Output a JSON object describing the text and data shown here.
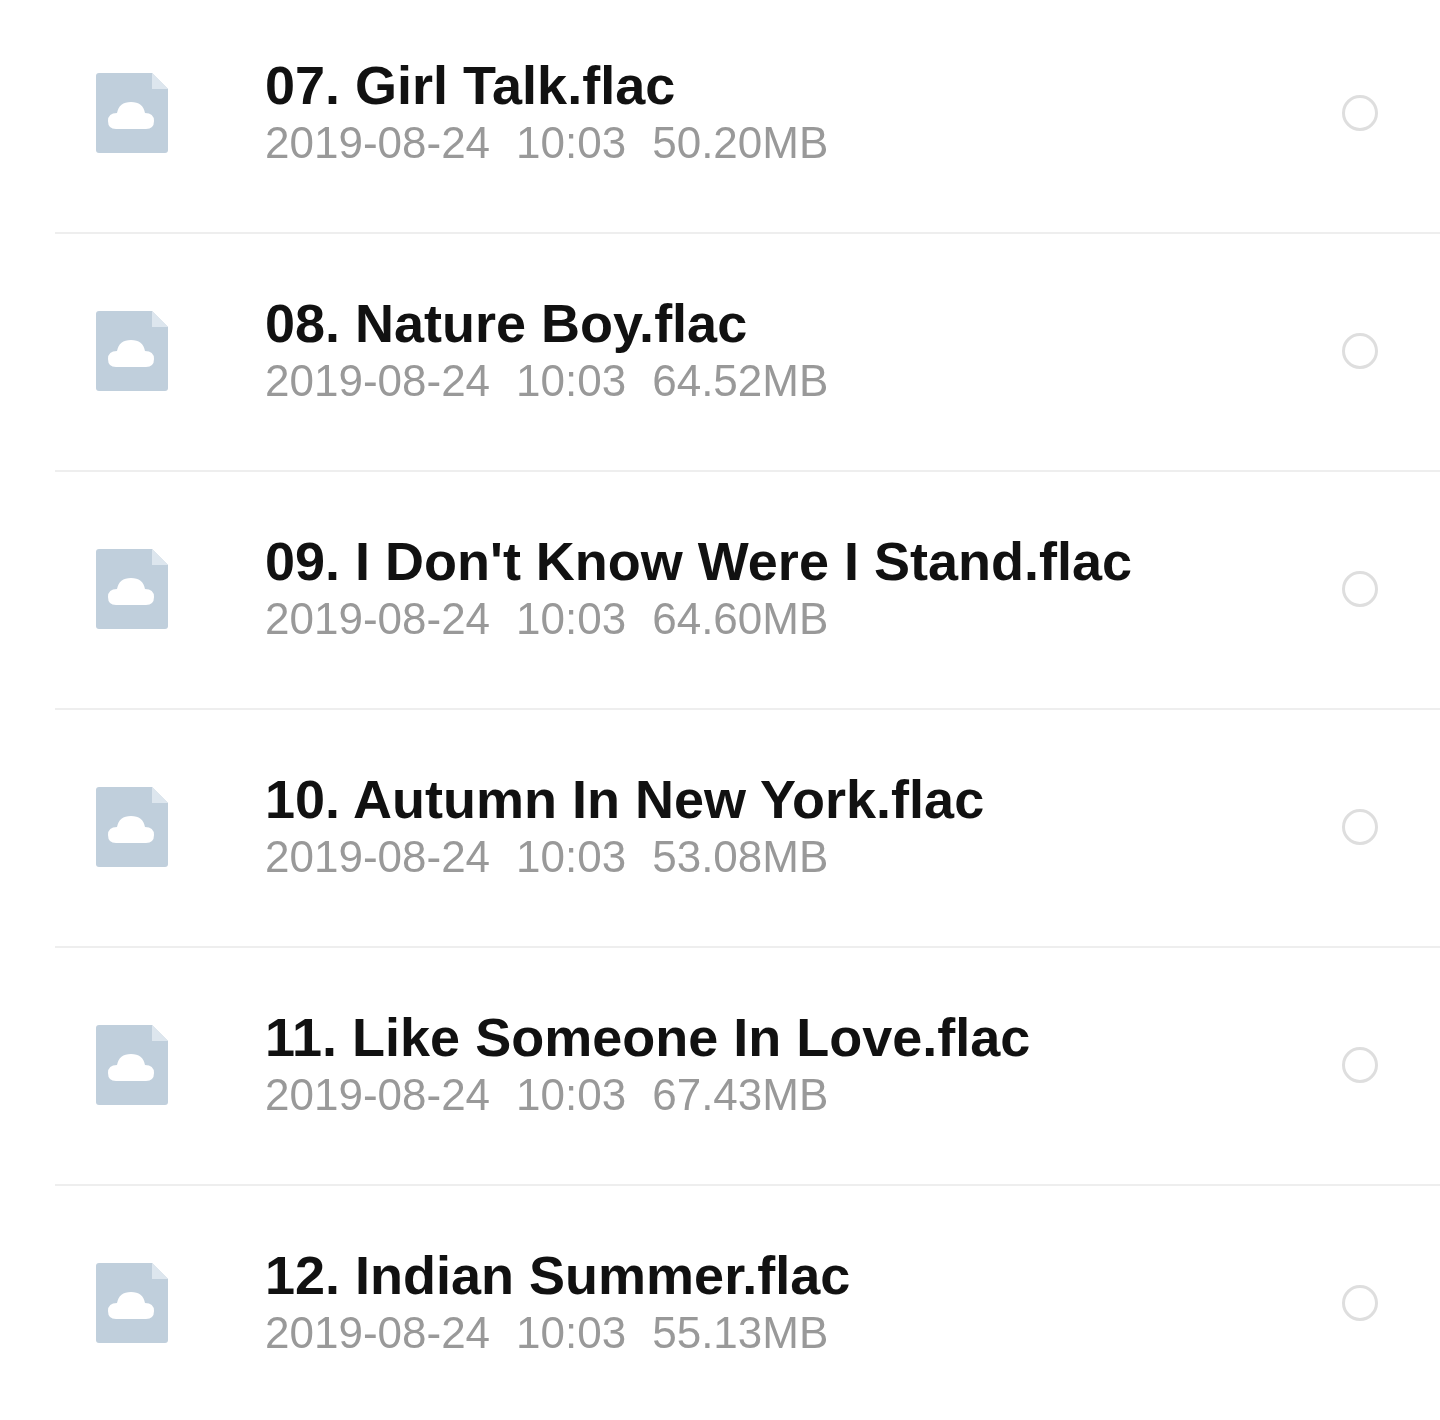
{
  "files": [
    {
      "name": "07. Girl Talk.flac",
      "date": "2019-08-24",
      "time": "10:03",
      "size": "50.20MB",
      "selected": false
    },
    {
      "name": "08. Nature Boy.flac",
      "date": "2019-08-24",
      "time": "10:03",
      "size": "64.52MB",
      "selected": false
    },
    {
      "name": "09. I Don't Know Were I Stand.flac",
      "date": "2019-08-24",
      "time": "10:03",
      "size": "64.60MB",
      "selected": false
    },
    {
      "name": "10. Autumn In New York.flac",
      "date": "2019-08-24",
      "time": "10:03",
      "size": "53.08MB",
      "selected": false
    },
    {
      "name": "11. Like Someone In Love.flac",
      "date": "2019-08-24",
      "time": "10:03",
      "size": "67.43MB",
      "selected": false
    },
    {
      "name": "12. Indian Summer.flac",
      "date": "2019-08-24",
      "time": "10:03",
      "size": "55.13MB",
      "selected": false
    }
  ]
}
